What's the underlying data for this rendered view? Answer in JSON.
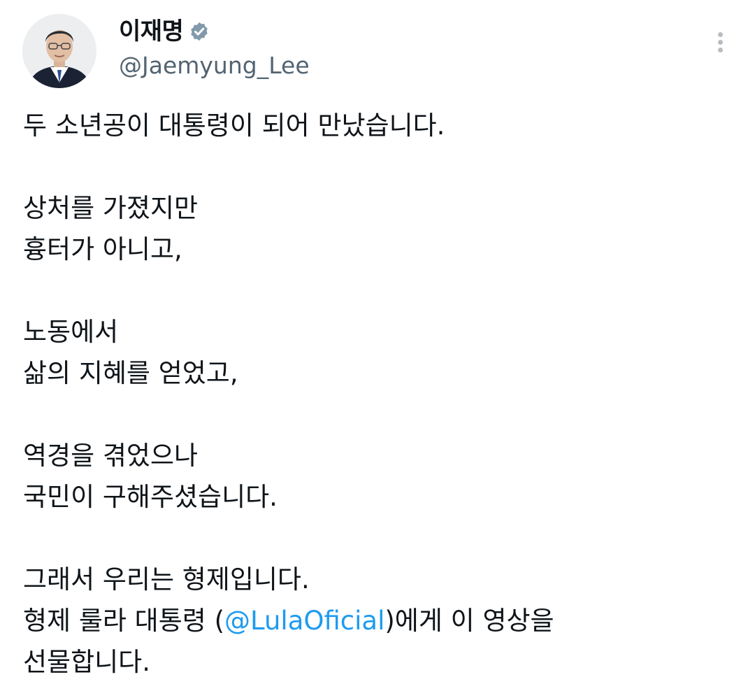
{
  "author": {
    "display_name": "이재명",
    "handle": "@Jaemyung_Lee",
    "verified_icon": "verified-badge-icon",
    "avatar_icon": "profile-photo"
  },
  "menu": {
    "icon": "more-options-icon"
  },
  "tweet": {
    "line1": "두 소년공이 대통령이 되어 만났습니다.",
    "line2": "상처를 가졌지만",
    "line3": "흉터가 아니고,",
    "line4": "노동에서",
    "line5": "삶의 지혜를 얻었고,",
    "line6": "역경을 겪었으나",
    "line7": "국민이 구해주셨습니다.",
    "line8": "그래서 우리는 형제입니다.",
    "line9_pre": "형제 룰라 대통령 (",
    "line9_mention": "@LulaOficial",
    "line9_post": ")에게 이 영상을",
    "line10": "선물합니다."
  },
  "colors": {
    "mention": "#1d9bf0",
    "handle": "#536471",
    "badge": "#829aab"
  }
}
